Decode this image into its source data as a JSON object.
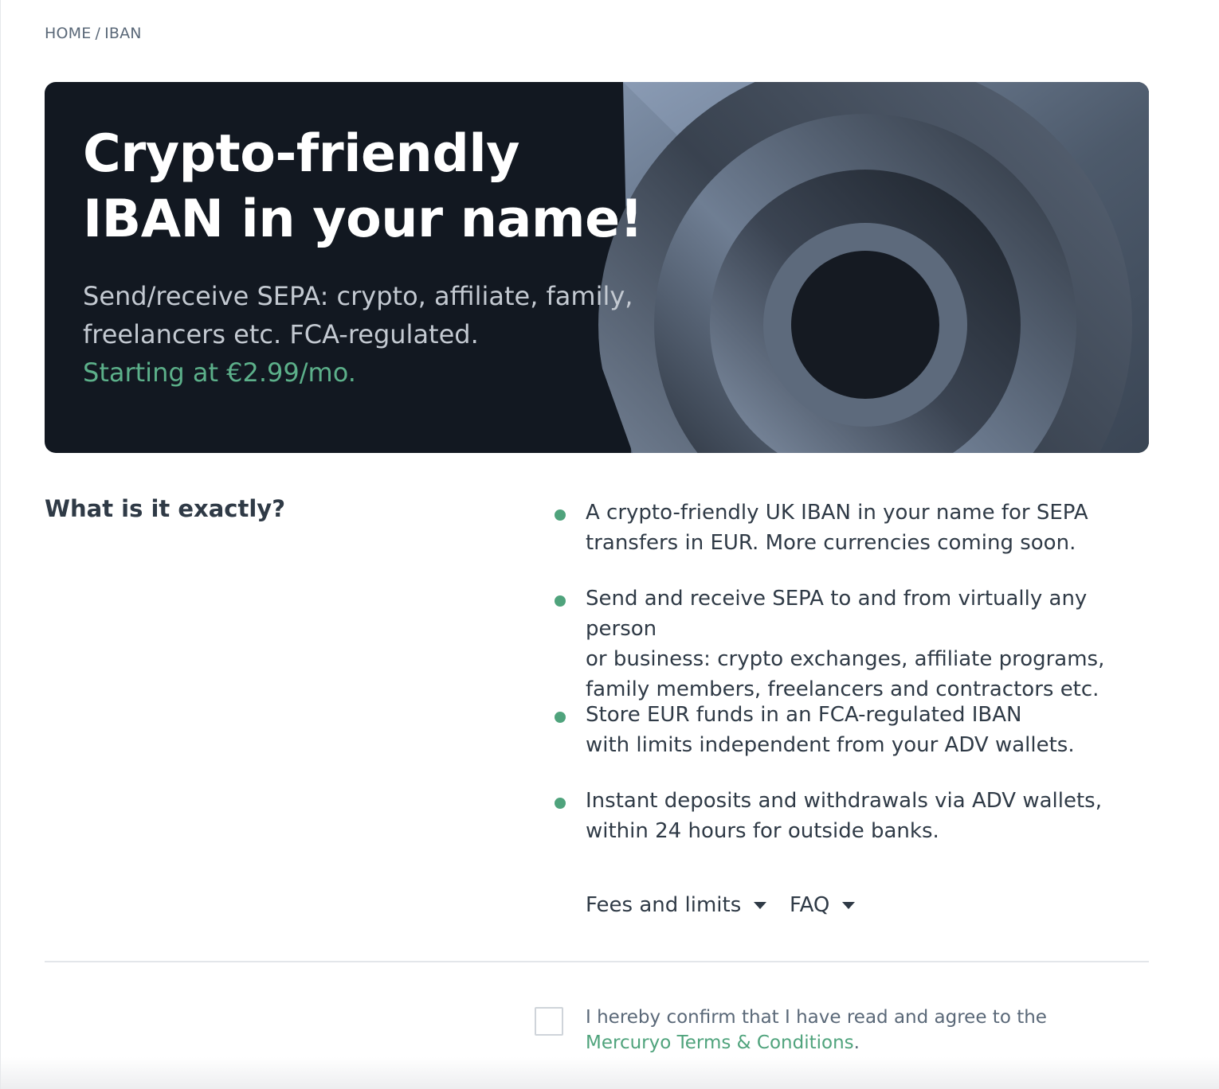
{
  "breadcrumb": {
    "home": "HOME",
    "separator": "/",
    "current": "IBAN"
  },
  "hero": {
    "title": "Crypto-friendly\nIBAN in your name!",
    "subtitle": "Send/receive SEPA: crypto, affiliate, family, freelancers etc. FCA-regulated.",
    "price": "Starting at €2.99/mo."
  },
  "section": {
    "title": "What is it exactly?"
  },
  "features": [
    {
      "text": "A crypto-friendly UK IBAN in your name for SEPA\ntransfers in EUR. More currencies coming soon."
    },
    {
      "text": "Send and receive SEPA to and from virtually any person\nor business: crypto exchanges, affiliate programs,\nfamily members, freelancers and contractors etc."
    },
    {
      "text": "Store EUR funds in an FCA-regulated IBAN\nwith limits independent from your ADV wallets."
    },
    {
      "text": "Instant deposits and withdrawals via ADV wallets,\nwithin 24 hours for outside banks."
    }
  ],
  "toggles": {
    "fees": "Fees and limits",
    "faq": "FAQ"
  },
  "consent": {
    "text": "I hereby confirm that I have read and agree to the ",
    "link": "Mercuryo Terms & Conditions",
    "suffix": "."
  },
  "colors": {
    "accent": "#4fa37c",
    "hero_bg": "#121821",
    "text": "#2f3a46"
  },
  "icons": {
    "bullet": "dot-icon",
    "toggle": "caret-down-icon"
  }
}
